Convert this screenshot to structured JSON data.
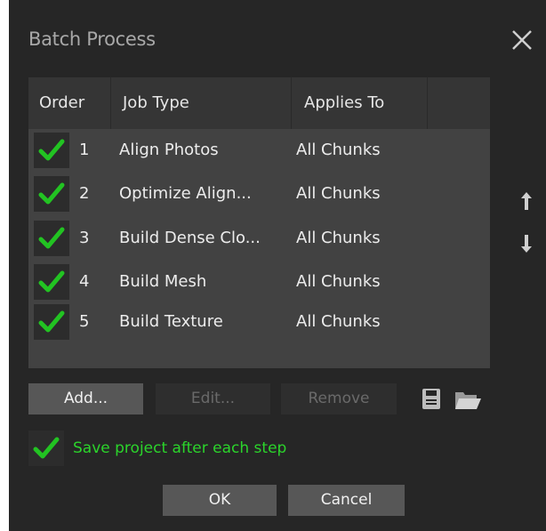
{
  "dialog": {
    "title": "Batch Process",
    "close_icon": "close-icon"
  },
  "table": {
    "columns": [
      "Order",
      "Job Type",
      "Applies To"
    ],
    "rows": [
      {
        "checked": true,
        "order": "1",
        "job_type": "Align Photos",
        "applies_to": "All Chunks"
      },
      {
        "checked": true,
        "order": "2",
        "job_type": "Optimize Align...",
        "applies_to": "All Chunks"
      },
      {
        "checked": true,
        "order": "3",
        "job_type": "Build Dense Clo...",
        "applies_to": "All Chunks"
      },
      {
        "checked": true,
        "order": "4",
        "job_type": "Build Mesh",
        "applies_to": "All Chunks"
      },
      {
        "checked": true,
        "order": "5",
        "job_type": "Build Texture",
        "applies_to": "All Chunks"
      }
    ]
  },
  "side_controls": {
    "move_up_icon": "arrow-up-icon",
    "move_down_icon": "arrow-down-icon"
  },
  "actions": {
    "add_label": "Add...",
    "edit_label": "Edit...",
    "remove_label": "Remove",
    "save_icon": "save-icon",
    "open_icon": "folder-open-icon"
  },
  "options": {
    "save_after_each_step_label": "Save project after each step",
    "save_after_each_step_checked": true
  },
  "footer": {
    "ok_label": "OK",
    "cancel_label": "Cancel"
  },
  "colors": {
    "background": "#262626",
    "table_background": "#424242",
    "header_background": "#353535",
    "check_green": "#22c322",
    "label_green": "#2bd42b",
    "button_enabled": "#575757",
    "button_disabled": "#2e2e2e"
  }
}
